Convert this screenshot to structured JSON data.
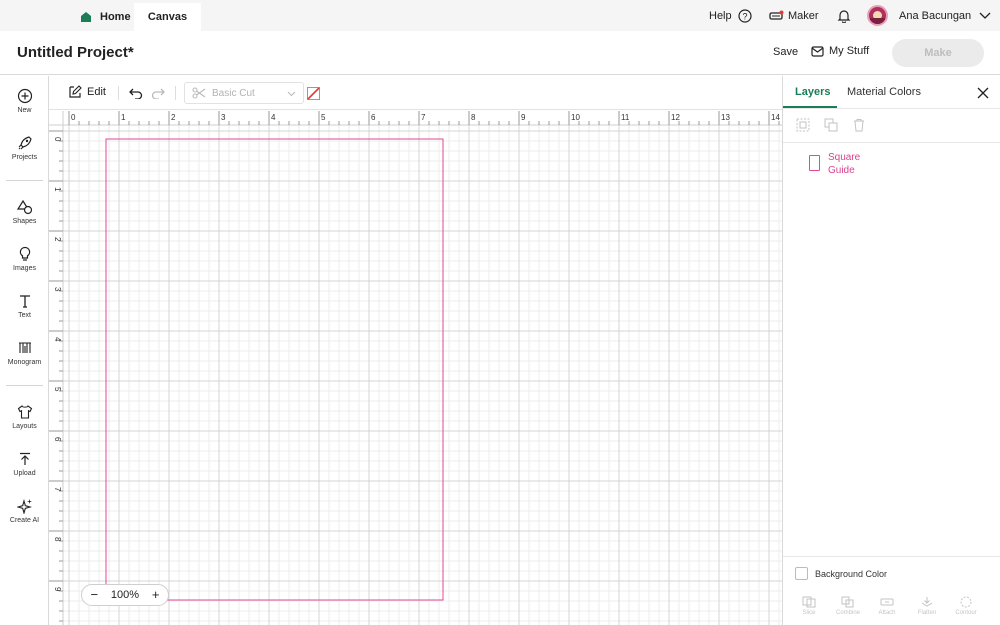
{
  "tabs": {
    "home": "Home",
    "canvas": "Canvas"
  },
  "header": {
    "help": "Help",
    "machine": "Maker",
    "user_name": "Ana Bacungan"
  },
  "project": {
    "title": "Untitled Project*",
    "save": "Save",
    "my_stuff": "My Stuff",
    "make": "Make"
  },
  "sidebar": {
    "items": [
      {
        "label": "New",
        "icon": "plus-circle-icon"
      },
      {
        "label": "Projects",
        "icon": "rocket-icon"
      },
      {
        "label": "Shapes",
        "icon": "shapes-icon"
      },
      {
        "label": "Images",
        "icon": "lightbulb-icon"
      },
      {
        "label": "Text",
        "icon": "text-icon"
      },
      {
        "label": "Monogram",
        "icon": "monogram-icon"
      },
      {
        "label": "Layouts",
        "icon": "shirt-icon"
      },
      {
        "label": "Upload",
        "icon": "upload-icon"
      },
      {
        "label": "Create AI",
        "icon": "sparkle-icon"
      }
    ]
  },
  "toolbar": {
    "edit": "Edit",
    "operation": "Basic Cut"
  },
  "canvas": {
    "ruler_top": [
      "0",
      "1",
      "2",
      "3",
      "4",
      "5",
      "6",
      "7",
      "8",
      "9",
      "10",
      "11",
      "12",
      "13",
      "14"
    ],
    "ruler_left": [
      "0",
      "1",
      "2",
      "3",
      "4",
      "5",
      "6",
      "7",
      "8",
      "9"
    ],
    "zoom": "100%"
  },
  "layers_panel": {
    "tab_layers": "Layers",
    "tab_colors": "Material Colors",
    "layer_name": "Square Guide",
    "background_color": "Background Color",
    "actions": [
      "Slice",
      "Combine",
      "Attach",
      "Flatten",
      "Contour"
    ]
  },
  "colors": {
    "accent_green": "#1b7d55",
    "guide_pink": "#e34a95"
  }
}
